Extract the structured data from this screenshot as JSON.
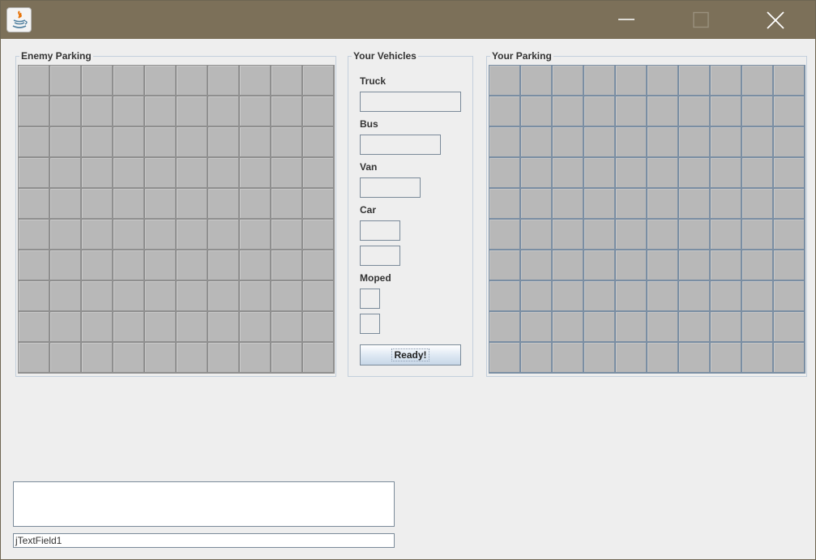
{
  "window": {
    "controls": {
      "minimize_icon": "minimize-icon",
      "maximize_icon": "maximize-icon",
      "close_icon": "close-icon"
    }
  },
  "enemy_parking": {
    "title": "Enemy Parking",
    "rows": 10,
    "cols": 10
  },
  "your_vehicles": {
    "title": "Your Vehicles",
    "labels": {
      "truck": "Truck",
      "bus": "Bus",
      "van": "Van",
      "car": "Car",
      "moped": "Moped"
    },
    "ready_button": "Ready!"
  },
  "your_parking": {
    "title": "Your Parking",
    "rows": 10,
    "cols": 10
  },
  "message_area": {
    "value": ""
  },
  "text_field": {
    "value": "jTextField1"
  },
  "colors": {
    "titlebar": "#7c7059",
    "window_bg": "#eeeeee",
    "cell": "#b8b8b8",
    "enemy_grid_lines": "#8f8f8f",
    "your_grid_lines": "#7a8ea3"
  }
}
